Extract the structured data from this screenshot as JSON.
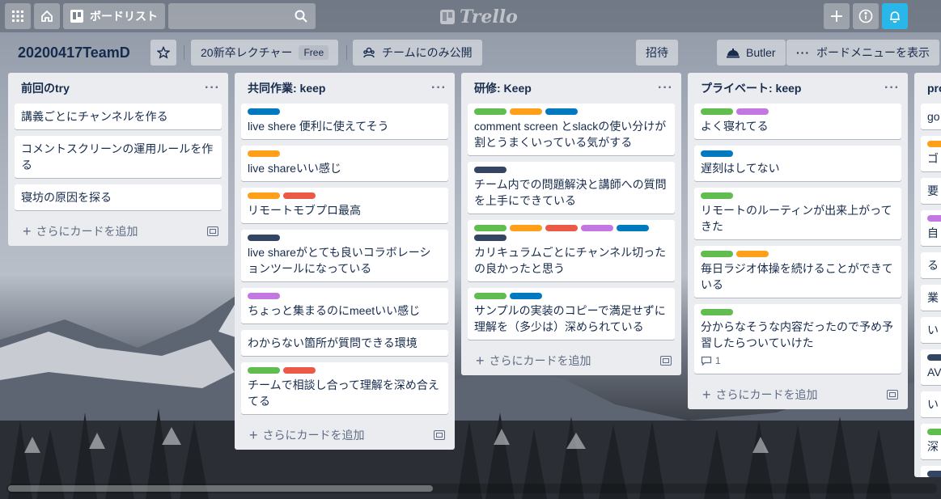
{
  "colors": {
    "green": "#61bd4f",
    "orange": "#ff9f1a",
    "blue": "#0079bf",
    "red": "#eb5a46",
    "purple": "#c377e0",
    "black": "#344563",
    "notification": "#29b6e8"
  },
  "nav": {
    "boards_label": "ボードリスト",
    "logo_text": "Trello"
  },
  "board": {
    "title": "20200417TeamD",
    "team_name": "20新卒レクチャー",
    "team_badge": "Free",
    "visibility": "チームにのみ公開",
    "invite_label": "招待",
    "butler_label": "Butler",
    "menu_label": "ボードメニューを表示"
  },
  "lists": [
    {
      "title": "前回のtry",
      "menu": "···",
      "add_label": "さらにカードを追加",
      "cards": [
        {
          "labels": [],
          "text": "講義ごとにチャンネルを作る"
        },
        {
          "labels": [],
          "text": "コメントスクリーンの運用ルールを作る"
        },
        {
          "labels": [],
          "text": "寝坊の原因を探る"
        }
      ]
    },
    {
      "title": "共同作業: keep",
      "menu": "···",
      "add_label": "さらにカードを追加",
      "cards": [
        {
          "labels": [
            "blue"
          ],
          "text": "live shere 便利に使えてそう"
        },
        {
          "labels": [
            "orange"
          ],
          "text": "live shareいい感じ"
        },
        {
          "labels": [
            "orange",
            "red"
          ],
          "text": "リモートモブプロ最高"
        },
        {
          "labels": [
            "black"
          ],
          "text": "live shareがとても良いコラボレーションツールになっている"
        },
        {
          "labels": [
            "purple"
          ],
          "text": "ちょっと集まるのにmeetいい感じ"
        },
        {
          "labels": [],
          "text": "わからない箇所が質問できる環境"
        },
        {
          "labels": [
            "green",
            "red"
          ],
          "text": "チームで相談し合って理解を深め合えてる"
        }
      ]
    },
    {
      "title": "研修: Keep",
      "menu": "···",
      "add_label": "さらにカードを追加",
      "cards": [
        {
          "labels": [
            "green",
            "orange",
            "blue"
          ],
          "text": "comment screen とslackの使い分けが割とうまくいっている気がする"
        },
        {
          "labels": [
            "black"
          ],
          "text": "チーム内での問題解決と講師への質問を上手にできている"
        },
        {
          "labels": [
            "green",
            "orange",
            "red",
            "purple",
            "blue",
            "black"
          ],
          "text": "カリキュラムごとにチャンネル切ったの良かったと思う"
        },
        {
          "labels": [
            "green",
            "blue"
          ],
          "text": "サンプルの実装のコピーで満足せずに理解を（多少は）深められている"
        }
      ]
    },
    {
      "title": "プライベート: keep",
      "menu": "···",
      "add_label": "さらにカードを追加",
      "cards": [
        {
          "labels": [
            "green",
            "purple"
          ],
          "text": "よく寝れてる"
        },
        {
          "labels": [
            "blue"
          ],
          "text": "遅刻はしてない"
        },
        {
          "labels": [
            "green"
          ],
          "text": "リモートのルーティンが出来上がってきた"
        },
        {
          "labels": [
            "green",
            "orange"
          ],
          "text": "毎日ラジオ体操を続けることができている"
        },
        {
          "labels": [
            "green"
          ],
          "text": "分からなそうな内容だったので予め予習したらついていけた",
          "comments": "1"
        }
      ]
    }
  ],
  "partial_list": {
    "title": "pro",
    "cards": [
      {
        "labels": [],
        "text": "go"
      },
      {
        "labels": [
          "orange"
        ],
        "text": "ゴ"
      },
      {
        "labels": [],
        "text": "要"
      },
      {
        "labels": [
          "purple"
        ],
        "text": "自"
      },
      {
        "labels": [],
        "text": "る"
      },
      {
        "labels": [],
        "text": "業"
      },
      {
        "labels": [],
        "text": "い"
      },
      {
        "labels": [
          "black"
        ],
        "text": "AV"
      },
      {
        "labels": [],
        "text": "い"
      },
      {
        "labels": [
          "green"
        ],
        "text": "深"
      },
      {
        "labels": [
          "black"
        ],
        "text": "チ"
      }
    ]
  }
}
